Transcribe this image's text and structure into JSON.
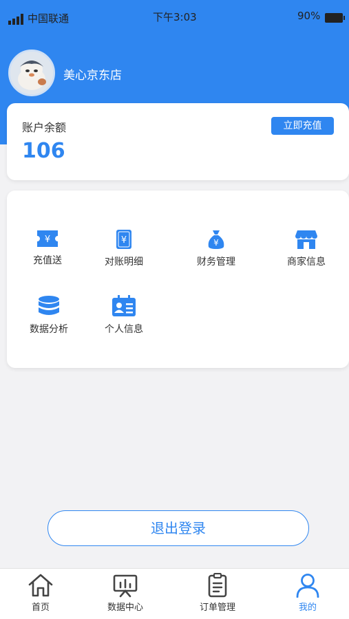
{
  "status_bar": {
    "carrier": "中国联通",
    "time": "下午3:03",
    "battery": "90%"
  },
  "profile": {
    "store_name": "美心京东店"
  },
  "balance": {
    "label": "账户余额",
    "value": "106",
    "recharge_label": "立即充值"
  },
  "menu": {
    "items": [
      {
        "label": "充值送",
        "icon": "ticket-icon"
      },
      {
        "label": "对账明细",
        "icon": "yen-book-icon"
      },
      {
        "label": "财务管理",
        "icon": "money-bag-icon"
      },
      {
        "label": "商家信息",
        "icon": "store-icon"
      },
      {
        "label": "数据分析",
        "icon": "database-icon"
      },
      {
        "label": "个人信息",
        "icon": "id-card-icon"
      }
    ]
  },
  "logout_label": "退出登录",
  "tabbar": {
    "items": [
      {
        "label": "首页",
        "icon": "home-icon"
      },
      {
        "label": "数据中心",
        "icon": "presentation-icon"
      },
      {
        "label": "订单管理",
        "icon": "clipboard-icon"
      },
      {
        "label": "我的",
        "icon": "user-icon"
      }
    ]
  },
  "colors": {
    "primary": "#2f86f0",
    "background": "#f2f2f4"
  }
}
